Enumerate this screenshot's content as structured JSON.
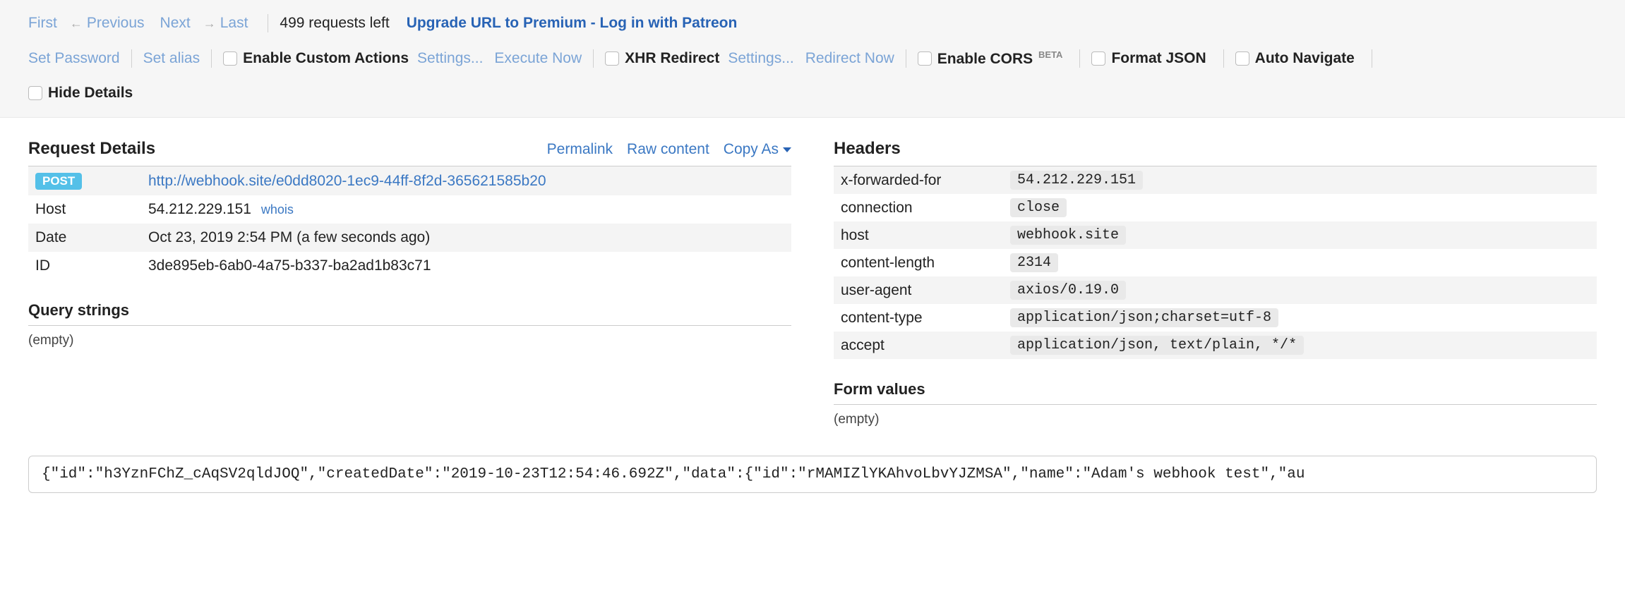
{
  "toolbar": {
    "nav": {
      "first": "First",
      "previous": "Previous",
      "next": "Next",
      "last": "Last"
    },
    "requests_left": "499 requests left",
    "upgrade": "Upgrade URL to Premium - Log in with Patreon",
    "set_password": "Set Password",
    "set_alias": "Set alias",
    "enable_custom_actions": "Enable Custom Actions",
    "settings": "Settings...",
    "execute_now": "Execute Now",
    "xhr_redirect": "XHR Redirect",
    "xhr_settings": "Settings...",
    "redirect_now": "Redirect Now",
    "enable_cors": "Enable CORS",
    "beta": "BETA",
    "format_json": "Format JSON",
    "auto_navigate": "Auto Navigate",
    "hide_details": "Hide Details"
  },
  "request": {
    "title": "Request Details",
    "actions": {
      "permalink": "Permalink",
      "raw_content": "Raw content",
      "copy_as": "Copy As"
    },
    "method": "POST",
    "url": "http://webhook.site/e0dd8020-1ec9-44ff-8f2d-365621585b20",
    "host_label": "Host",
    "host": "54.212.229.151",
    "whois": "whois",
    "date_label": "Date",
    "date": "Oct 23, 2019 2:54 PM (a few seconds ago)",
    "id_label": "ID",
    "id": "3de895eb-6ab0-4a75-b337-ba2ad1b83c71"
  },
  "headers": {
    "title": "Headers",
    "rows": [
      {
        "name": "x-forwarded-for",
        "value": "54.212.229.151"
      },
      {
        "name": "connection",
        "value": "close"
      },
      {
        "name": "host",
        "value": "webhook.site"
      },
      {
        "name": "content-length",
        "value": "2314"
      },
      {
        "name": "user-agent",
        "value": "axios/0.19.0"
      },
      {
        "name": "content-type",
        "value": "application/json;charset=utf-8"
      },
      {
        "name": "accept",
        "value": "application/json, text/plain, */*"
      }
    ]
  },
  "query_strings": {
    "title": "Query strings",
    "empty": "(empty)"
  },
  "form_values": {
    "title": "Form values",
    "empty": "(empty)"
  },
  "raw_body": "{\"id\":\"h3YznFChZ_cAqSV2qldJOQ\",\"createdDate\":\"2019-10-23T12:54:46.692Z\",\"data\":{\"id\":\"rMAMIZlYKAhvoLbvYJZMSA\",\"name\":\"Adam's webhook test\",\"au"
}
